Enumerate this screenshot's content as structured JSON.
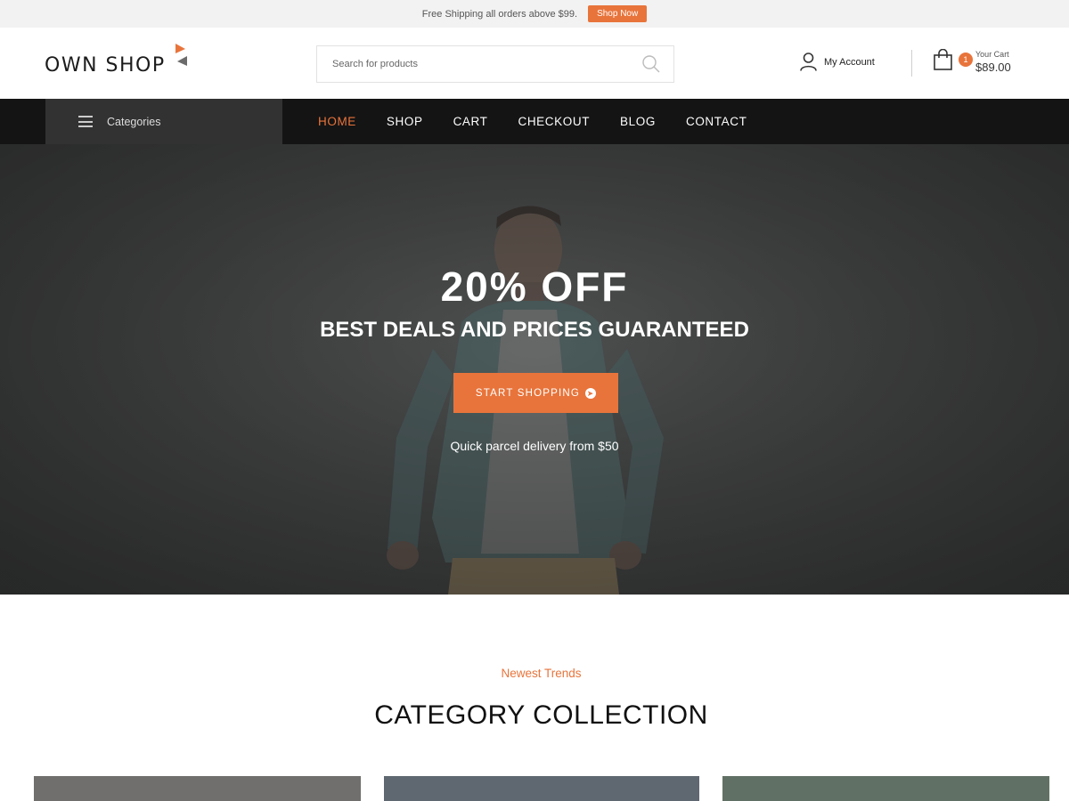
{
  "topbar": {
    "shipping_text": "Free Shipping all orders above $99.",
    "shop_now_label": "Shop Now"
  },
  "header": {
    "logo_text": "OWN SHOP",
    "search": {
      "placeholder": "Search for products"
    },
    "account_label": "My Account",
    "cart": {
      "count": "1",
      "label": "Your Cart",
      "total": "$89.00"
    }
  },
  "nav": {
    "categories_label": "Categories",
    "links": [
      {
        "label": "HOME",
        "active": true
      },
      {
        "label": "SHOP",
        "active": false
      },
      {
        "label": "CART",
        "active": false
      },
      {
        "label": "CHECKOUT",
        "active": false
      },
      {
        "label": "BLOG",
        "active": false
      },
      {
        "label": "CONTACT",
        "active": false
      }
    ]
  },
  "hero": {
    "title": "20% OFF",
    "subtitle": "BEST DEALS AND PRICES GUARANTEED",
    "button_label": "START SHOPPING",
    "note": "Quick parcel delivery from $50"
  },
  "section": {
    "kicker": "Newest Trends",
    "title": "CATEGORY COLLECTION"
  },
  "colors": {
    "accent": "#e8743b",
    "nav_bg": "#141414",
    "categories_bg": "#323232"
  },
  "icons": [
    "flag-logo-icon",
    "search-icon",
    "user-icon",
    "shopping-bag-icon",
    "menu-icon",
    "arrow-circle-right-icon"
  ]
}
